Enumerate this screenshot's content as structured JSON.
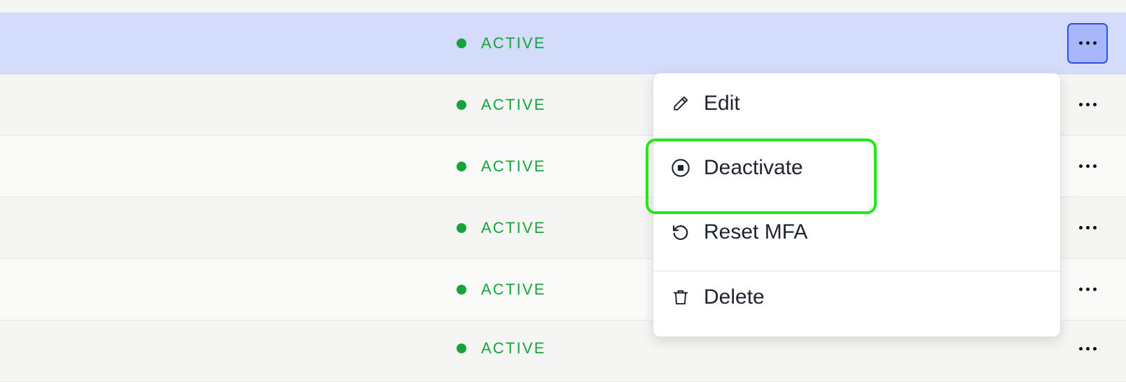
{
  "rows": [
    {
      "status": "ACTIVE"
    },
    {
      "status": "ACTIVE"
    },
    {
      "status": "ACTIVE"
    },
    {
      "status": "ACTIVE"
    },
    {
      "status": "ACTIVE"
    },
    {
      "status": "ACTIVE"
    }
  ],
  "colors": {
    "status_active": "#16a33a",
    "selected_row": "#d3dcfb",
    "actions_active_bg": "#a8b6fb",
    "actions_active_border": "#2f4ee8",
    "highlight": "#22e81a"
  },
  "menu": {
    "items": [
      {
        "label": "Edit",
        "icon": "pencil-icon"
      },
      {
        "label": "Deactivate",
        "icon": "stop-circle-icon"
      },
      {
        "label": "Reset MFA",
        "icon": "refresh-icon"
      },
      {
        "label": "Delete",
        "icon": "trash-icon"
      }
    ]
  }
}
